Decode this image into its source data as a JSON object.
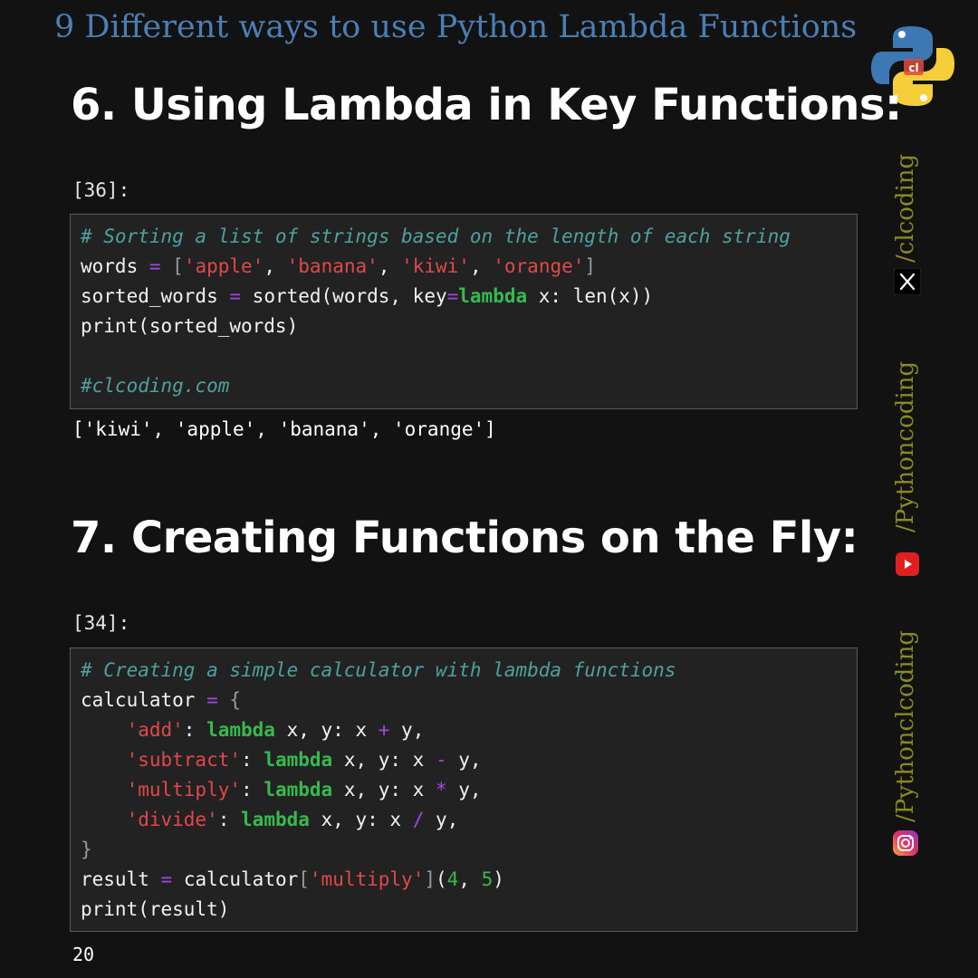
{
  "series_title": "9 Different ways to use Python Lambda Functions",
  "sections": [
    {
      "heading": "6. Using Lambda in Key Functions:",
      "cell_label": "[36]:",
      "code_lines": [
        "# Sorting a list of strings based on the length of each string",
        "words = ['apple', 'banana', 'kiwi', 'orange']",
        "sorted_words = sorted(words, key=lambda x: len(x))",
        "print(sorted_words)",
        "",
        "#clcoding.com"
      ],
      "output": "['kiwi', 'apple', 'banana', 'orange']"
    },
    {
      "heading": "7. Creating Functions on the Fly:",
      "cell_label": "[34]:",
      "code_lines": [
        "# Creating a simple calculator with lambda functions",
        "calculator = {",
        "    'add': lambda x, y: x + y,",
        "    'subtract': lambda x, y: x - y,",
        "    'multiply': lambda x, y: x * y,",
        "    'divide': lambda x, y: x / y,",
        "}",
        "result = calculator['multiply'](4, 5)",
        "print(result)"
      ]
    }
  ],
  "page_number": "20",
  "social": {
    "x_handle": "/clcoding",
    "youtube_handle": "/Pythoncoding",
    "instagram_handle": "/Pythonclcoding"
  },
  "icons": {
    "logo": "python-logo-icon",
    "x": "x-icon",
    "youtube": "youtube-icon",
    "instagram": "instagram-icon"
  },
  "colors": {
    "background": "#121212",
    "title": "#4a7fb5",
    "handle": "#8a8a24",
    "comment": "#4fa0a0",
    "string": "#e0484a",
    "keyword": "#37b94e",
    "operator": "#a545e8"
  }
}
